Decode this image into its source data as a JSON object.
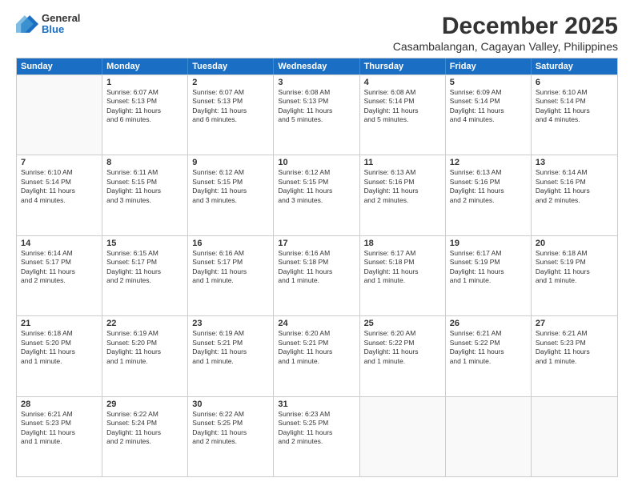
{
  "logo": {
    "general": "General",
    "blue": "Blue"
  },
  "title": "December 2025",
  "location": "Casambalangan, Cagayan Valley, Philippines",
  "header_days": [
    "Sunday",
    "Monday",
    "Tuesday",
    "Wednesday",
    "Thursday",
    "Friday",
    "Saturday"
  ],
  "weeks": [
    [
      {
        "day": "",
        "info": ""
      },
      {
        "day": "1",
        "info": "Sunrise: 6:07 AM\nSunset: 5:13 PM\nDaylight: 11 hours\nand 6 minutes."
      },
      {
        "day": "2",
        "info": "Sunrise: 6:07 AM\nSunset: 5:13 PM\nDaylight: 11 hours\nand 6 minutes."
      },
      {
        "day": "3",
        "info": "Sunrise: 6:08 AM\nSunset: 5:13 PM\nDaylight: 11 hours\nand 5 minutes."
      },
      {
        "day": "4",
        "info": "Sunrise: 6:08 AM\nSunset: 5:14 PM\nDaylight: 11 hours\nand 5 minutes."
      },
      {
        "day": "5",
        "info": "Sunrise: 6:09 AM\nSunset: 5:14 PM\nDaylight: 11 hours\nand 4 minutes."
      },
      {
        "day": "6",
        "info": "Sunrise: 6:10 AM\nSunset: 5:14 PM\nDaylight: 11 hours\nand 4 minutes."
      }
    ],
    [
      {
        "day": "7",
        "info": "Sunrise: 6:10 AM\nSunset: 5:14 PM\nDaylight: 11 hours\nand 4 minutes."
      },
      {
        "day": "8",
        "info": "Sunrise: 6:11 AM\nSunset: 5:15 PM\nDaylight: 11 hours\nand 3 minutes."
      },
      {
        "day": "9",
        "info": "Sunrise: 6:12 AM\nSunset: 5:15 PM\nDaylight: 11 hours\nand 3 minutes."
      },
      {
        "day": "10",
        "info": "Sunrise: 6:12 AM\nSunset: 5:15 PM\nDaylight: 11 hours\nand 3 minutes."
      },
      {
        "day": "11",
        "info": "Sunrise: 6:13 AM\nSunset: 5:16 PM\nDaylight: 11 hours\nand 2 minutes."
      },
      {
        "day": "12",
        "info": "Sunrise: 6:13 AM\nSunset: 5:16 PM\nDaylight: 11 hours\nand 2 minutes."
      },
      {
        "day": "13",
        "info": "Sunrise: 6:14 AM\nSunset: 5:16 PM\nDaylight: 11 hours\nand 2 minutes."
      }
    ],
    [
      {
        "day": "14",
        "info": "Sunrise: 6:14 AM\nSunset: 5:17 PM\nDaylight: 11 hours\nand 2 minutes."
      },
      {
        "day": "15",
        "info": "Sunrise: 6:15 AM\nSunset: 5:17 PM\nDaylight: 11 hours\nand 2 minutes."
      },
      {
        "day": "16",
        "info": "Sunrise: 6:16 AM\nSunset: 5:17 PM\nDaylight: 11 hours\nand 1 minute."
      },
      {
        "day": "17",
        "info": "Sunrise: 6:16 AM\nSunset: 5:18 PM\nDaylight: 11 hours\nand 1 minute."
      },
      {
        "day": "18",
        "info": "Sunrise: 6:17 AM\nSunset: 5:18 PM\nDaylight: 11 hours\nand 1 minute."
      },
      {
        "day": "19",
        "info": "Sunrise: 6:17 AM\nSunset: 5:19 PM\nDaylight: 11 hours\nand 1 minute."
      },
      {
        "day": "20",
        "info": "Sunrise: 6:18 AM\nSunset: 5:19 PM\nDaylight: 11 hours\nand 1 minute."
      }
    ],
    [
      {
        "day": "21",
        "info": "Sunrise: 6:18 AM\nSunset: 5:20 PM\nDaylight: 11 hours\nand 1 minute."
      },
      {
        "day": "22",
        "info": "Sunrise: 6:19 AM\nSunset: 5:20 PM\nDaylight: 11 hours\nand 1 minute."
      },
      {
        "day": "23",
        "info": "Sunrise: 6:19 AM\nSunset: 5:21 PM\nDaylight: 11 hours\nand 1 minute."
      },
      {
        "day": "24",
        "info": "Sunrise: 6:20 AM\nSunset: 5:21 PM\nDaylight: 11 hours\nand 1 minute."
      },
      {
        "day": "25",
        "info": "Sunrise: 6:20 AM\nSunset: 5:22 PM\nDaylight: 11 hours\nand 1 minute."
      },
      {
        "day": "26",
        "info": "Sunrise: 6:21 AM\nSunset: 5:22 PM\nDaylight: 11 hours\nand 1 minute."
      },
      {
        "day": "27",
        "info": "Sunrise: 6:21 AM\nSunset: 5:23 PM\nDaylight: 11 hours\nand 1 minute."
      }
    ],
    [
      {
        "day": "28",
        "info": "Sunrise: 6:21 AM\nSunset: 5:23 PM\nDaylight: 11 hours\nand 1 minute."
      },
      {
        "day": "29",
        "info": "Sunrise: 6:22 AM\nSunset: 5:24 PM\nDaylight: 11 hours\nand 2 minutes."
      },
      {
        "day": "30",
        "info": "Sunrise: 6:22 AM\nSunset: 5:25 PM\nDaylight: 11 hours\nand 2 minutes."
      },
      {
        "day": "31",
        "info": "Sunrise: 6:23 AM\nSunset: 5:25 PM\nDaylight: 11 hours\nand 2 minutes."
      },
      {
        "day": "",
        "info": ""
      },
      {
        "day": "",
        "info": ""
      },
      {
        "day": "",
        "info": ""
      }
    ]
  ]
}
